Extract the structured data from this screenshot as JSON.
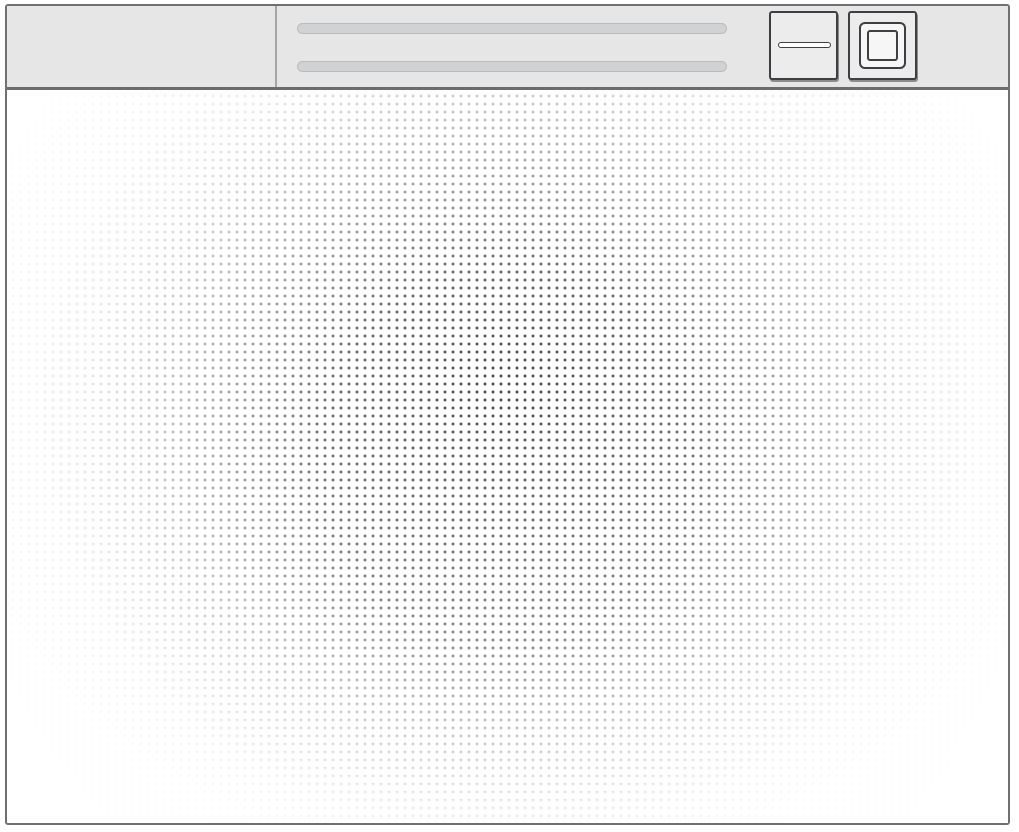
{
  "window": {
    "title_placeholder": "",
    "controls": {
      "minimize_icon": "minimize-icon",
      "maximize_icon": "maximize-icon"
    }
  },
  "colors": {
    "titlebar": "#e6e6e6",
    "border": "#6e7073",
    "dots": "#4a4d52"
  }
}
